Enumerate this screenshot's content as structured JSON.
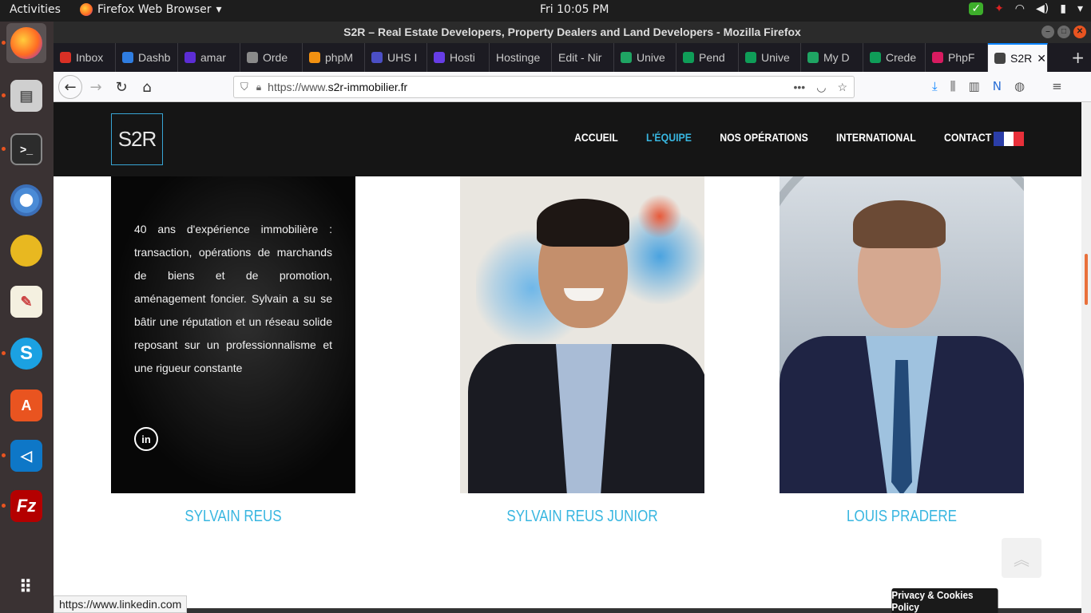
{
  "topbar": {
    "activities": "Activities",
    "app_name": "Firefox Web Browser",
    "clock": "Fri 10:05 PM"
  },
  "window": {
    "title": "S2R – Real Estate Developers, Property Dealers and Land Developers - Mozilla Firefox"
  },
  "tabs": [
    {
      "label": "Inbox",
      "color": "#d93025"
    },
    {
      "label": "Dashb",
      "color": "#2f7de1"
    },
    {
      "label": "amar",
      "color": "#5c2dd5"
    },
    {
      "label": "Orde",
      "color": "#8a8a8a"
    },
    {
      "label": "phpM",
      "color": "#f29111"
    },
    {
      "label": "UHS I",
      "color": "#4b4fc5"
    },
    {
      "label": "Hosti",
      "color": "#673de6"
    },
    {
      "label": "Hostinge",
      "color": ""
    },
    {
      "label": "Edit - Nir",
      "color": ""
    },
    {
      "label": "Unive",
      "color": "#1fa463"
    },
    {
      "label": "Pend",
      "color": "#0f9d58"
    },
    {
      "label": "Unive",
      "color": "#0f9d58"
    },
    {
      "label": "My D",
      "color": "#1fa463"
    },
    {
      "label": "Crede",
      "color": "#0f9d58"
    },
    {
      "label": "PhpF",
      "color": "#d81b60"
    },
    {
      "label": "S2R",
      "color": "#444"
    }
  ],
  "url": {
    "prefix": "https://www.",
    "domain": "s2r-immobilier.fr"
  },
  "site": {
    "logo_text": "S2R",
    "nav": [
      "ACCUEIL",
      "L'ÉQUIPE",
      "NOS OPÉRATIONS",
      "INTERNATIONAL",
      "CONTACT"
    ],
    "active_nav": "L'ÉQUIPE",
    "accent_color": "#38b6e0"
  },
  "team": [
    {
      "name": "SYLVAIN REUS",
      "bio": "40 ans d'expérience immobilière : transaction, opérations de marchands de biens et de promotion, aménagement foncier. Sylvain a su se bâtir une réputation et un réseau solide reposant sur un professionnalisme et une rigueur constante",
      "social": "in"
    },
    {
      "name": "SYLVAIN REUS JUNIOR"
    },
    {
      "name": "LOUIS PRADERE"
    }
  ],
  "privacy_label": "Privacy & Cookies Policy",
  "scroll_top_icon": "chevron-double-up-icon",
  "status_bar_link": "https://www.linkedin.com"
}
